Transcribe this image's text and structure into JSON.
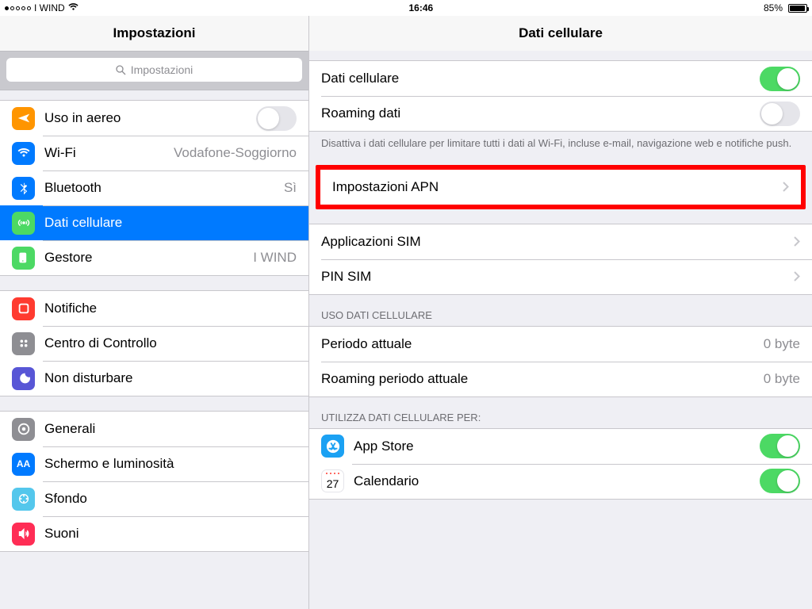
{
  "status": {
    "carrier": "I WIND",
    "time": "16:46",
    "battery": "85%"
  },
  "sidebar": {
    "title": "Impostazioni",
    "search_placeholder": "Impostazioni",
    "groups": [
      {
        "rows": [
          {
            "icon": "airplane",
            "label": "Uso in aereo",
            "toggle": false
          },
          {
            "icon": "wifi",
            "label": "Wi-Fi",
            "value": "Vodafone-Soggiorno"
          },
          {
            "icon": "bt",
            "label": "Bluetooth",
            "value": "Sì"
          },
          {
            "icon": "cell",
            "label": "Dati cellulare",
            "selected": true
          },
          {
            "icon": "carrier",
            "label": "Gestore",
            "value": "I WIND"
          }
        ]
      },
      {
        "rows": [
          {
            "icon": "notif",
            "label": "Notifiche"
          },
          {
            "icon": "control",
            "label": "Centro di Controllo"
          },
          {
            "icon": "dnd",
            "label": "Non disturbare"
          }
        ]
      },
      {
        "rows": [
          {
            "icon": "general",
            "label": "Generali"
          },
          {
            "icon": "display",
            "label": "Schermo e luminosità"
          },
          {
            "icon": "wallpaper",
            "label": "Sfondo"
          },
          {
            "icon": "sound",
            "label": "Suoni"
          }
        ]
      }
    ]
  },
  "detail": {
    "title": "Dati cellulare",
    "main_toggles": [
      {
        "label": "Dati cellulare",
        "on": true
      },
      {
        "label": "Roaming dati",
        "on": false
      }
    ],
    "main_footer": "Disattiva i dati cellulare per limitare tutti i dati al Wi-Fi, incluse e-mail, navigazione web e notifiche push.",
    "apn": {
      "label": "Impostazioni APN"
    },
    "sim_rows": [
      {
        "label": "Applicazioni SIM"
      },
      {
        "label": "PIN SIM"
      }
    ],
    "usage_header": "USO DATI CELLULARE",
    "usage_rows": [
      {
        "label": "Periodo attuale",
        "value": "0 byte"
      },
      {
        "label": "Roaming periodo attuale",
        "value": "0 byte"
      }
    ],
    "app_header": "UTILIZZA DATI CELLULARE PER:",
    "app_rows": [
      {
        "icon": "appstore",
        "label": "App Store",
        "on": true
      },
      {
        "icon": "calendar",
        "label": "Calendario",
        "on": true
      }
    ]
  }
}
